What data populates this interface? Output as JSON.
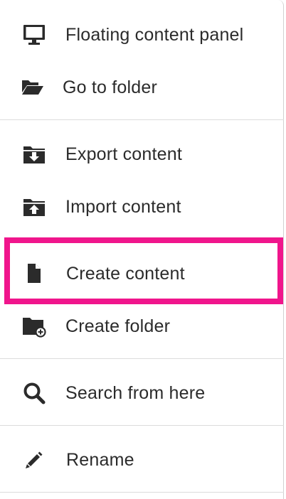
{
  "menu": {
    "items": [
      {
        "label": "Floating content panel",
        "icon": "monitor-icon"
      },
      {
        "label": "Go to folder",
        "icon": "folder-open-icon"
      },
      {
        "label": "Export content",
        "icon": "folder-export-icon"
      },
      {
        "label": "Import content",
        "icon": "folder-import-icon"
      },
      {
        "label": "Create content",
        "icon": "file-icon"
      },
      {
        "label": "Create folder",
        "icon": "folder-add-icon"
      },
      {
        "label": "Search from here",
        "icon": "search-icon"
      },
      {
        "label": "Rename",
        "icon": "pencil-icon"
      }
    ]
  },
  "highlight": {
    "color": "#f0158c",
    "target": "Create content"
  }
}
